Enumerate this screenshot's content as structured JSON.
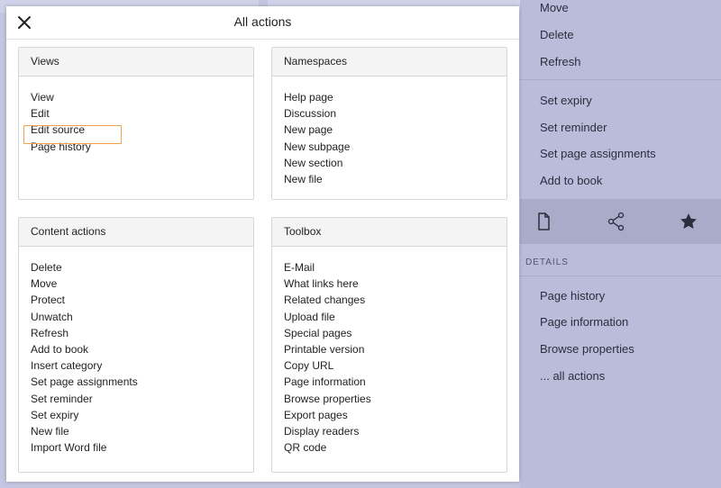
{
  "modal": {
    "title": "All actions",
    "panels": [
      {
        "heading": "Views",
        "items": [
          "View",
          "Edit",
          "Edit source",
          "Page history"
        ]
      },
      {
        "heading": "Namespaces",
        "items": [
          "Help page",
          "Discussion",
          "New page",
          "New subpage",
          "New section",
          "New file"
        ]
      },
      {
        "heading": "Content actions",
        "items": [
          "Delete",
          "Move",
          "Protect",
          "Unwatch",
          "Refresh",
          "Add to book",
          "Insert category",
          "Set page assignments",
          "Set reminder",
          "Set expiry",
          "New file",
          "Import Word file"
        ]
      },
      {
        "heading": "Toolbox",
        "items": [
          "E-Mail",
          "What links here",
          "Related changes",
          "Upload file",
          "Special pages",
          "Printable version",
          "Copy URL",
          "Page information",
          "Browse properties",
          "Export pages",
          "Display readers",
          "QR code"
        ]
      }
    ],
    "highlighted_item": "Edit source"
  },
  "sidebar": {
    "top_links": [
      "Move",
      "Delete",
      "Refresh"
    ],
    "mid_links": [
      "Set expiry",
      "Set reminder",
      "Set page assignments",
      "Add to book"
    ],
    "details_heading": "DETAILS",
    "details_links": [
      "Page history",
      "Page information",
      "Browse properties",
      "... all actions"
    ]
  },
  "colors": {
    "highlight": "#f2a04a",
    "overlay": "#b9bcd8"
  }
}
